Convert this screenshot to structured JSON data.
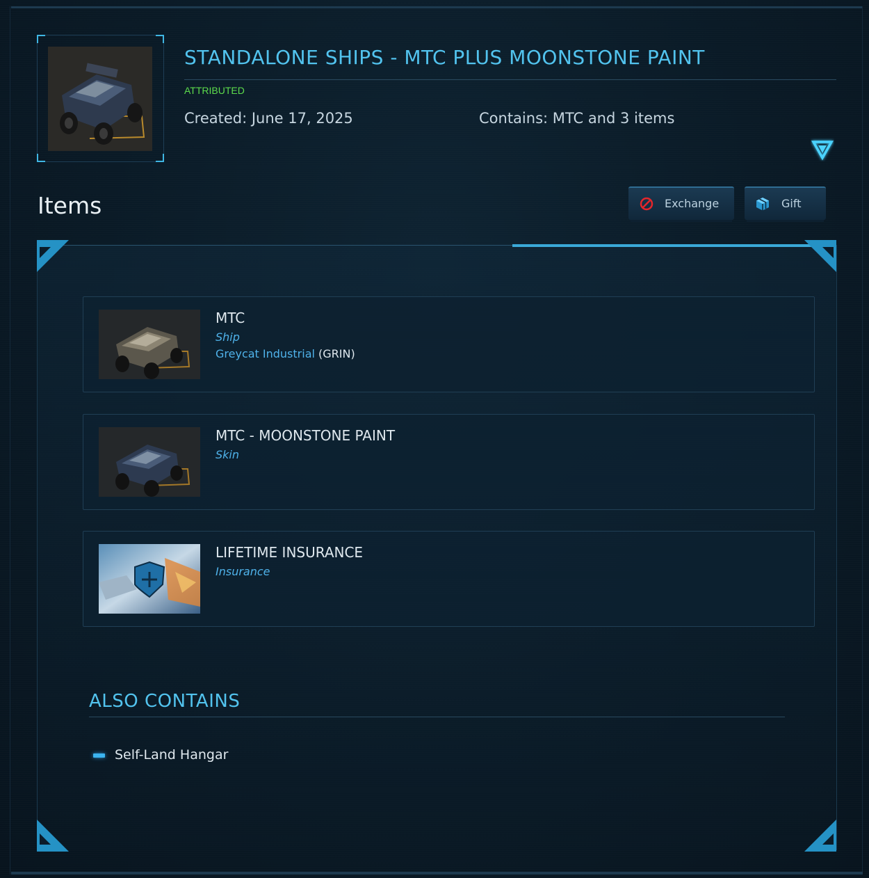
{
  "package": {
    "title": "STANDALONE SHIPS - MTC PLUS MOONSTONE PAINT",
    "status": "ATTRIBUTED",
    "created": "Created: June 17, 2025",
    "contains": "Contains: MTC and 3 items",
    "thumbnail_icon": "mtc-vehicle-image"
  },
  "items_section": {
    "heading": "Items",
    "actions": {
      "exchange_label": "Exchange",
      "exchange_icon": "no-entry-icon",
      "gift_label": "Gift",
      "gift_icon": "gift-icon"
    }
  },
  "items": [
    {
      "name": "MTC",
      "type": "Ship",
      "manufacturer": "Greycat Industrial",
      "manufacturer_code": "(GRIN)",
      "image": "mtc-vehicle-image"
    },
    {
      "name": "MTC - MOONSTONE PAINT",
      "type": "Skin",
      "image": "mtc-moonstone-image"
    },
    {
      "name": "LIFETIME INSURANCE",
      "type": "Insurance",
      "image": "insurance-shield-image"
    }
  ],
  "also_contains": {
    "heading": "ALSO CONTAINS",
    "items": [
      "Self-Land Hangar"
    ]
  },
  "colors": {
    "accent": "#52c3ee",
    "attributed": "#5ddc4c",
    "link": "#4fb2ea",
    "background": "#0a1a26"
  }
}
